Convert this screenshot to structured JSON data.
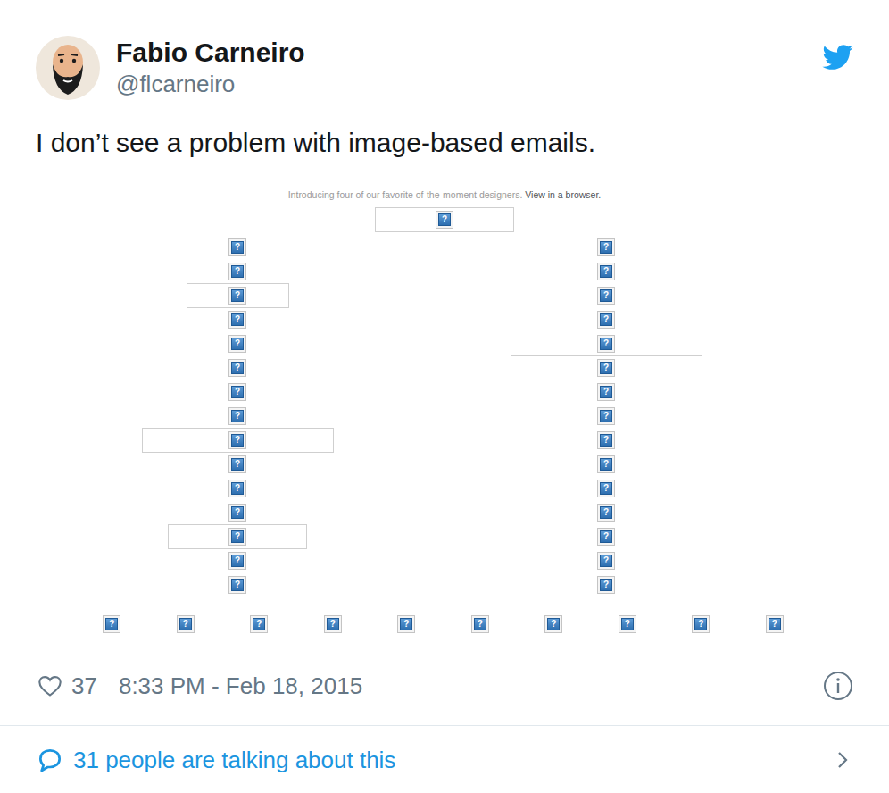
{
  "author": {
    "name": "Fabio Carneiro",
    "handle": "@flcarneiro"
  },
  "tweet": {
    "text": "I don’t see a problem with image-based emails."
  },
  "email": {
    "preheader": "Introducing four of our favorite of-the-moment designers.",
    "view_link": "View in a browser.",
    "broken_image_glyph": "?",
    "header_image": {
      "kind": "medium"
    },
    "columns": [
      {
        "items": [
          {
            "kind": "icon"
          },
          {
            "kind": "icon"
          },
          {
            "kind": "narrow"
          },
          {
            "kind": "icon"
          },
          {
            "kind": "icon"
          },
          {
            "kind": "icon"
          },
          {
            "kind": "icon"
          },
          {
            "kind": "icon"
          },
          {
            "kind": "wide"
          },
          {
            "kind": "icon"
          },
          {
            "kind": "icon"
          },
          {
            "kind": "icon"
          },
          {
            "kind": "medium"
          },
          {
            "kind": "icon"
          },
          {
            "kind": "icon"
          }
        ]
      },
      {
        "items": [
          {
            "kind": "icon"
          },
          {
            "kind": "icon"
          },
          {
            "kind": "icon"
          },
          {
            "kind": "icon"
          },
          {
            "kind": "icon"
          },
          {
            "kind": "wide"
          },
          {
            "kind": "icon"
          },
          {
            "kind": "icon"
          },
          {
            "kind": "icon"
          },
          {
            "kind": "icon"
          },
          {
            "kind": "icon"
          },
          {
            "kind": "icon"
          },
          {
            "kind": "icon"
          },
          {
            "kind": "icon"
          },
          {
            "kind": "icon"
          }
        ]
      }
    ],
    "footer_images": [
      {
        "kind": "icon"
      },
      {
        "kind": "icon"
      },
      {
        "kind": "icon"
      },
      {
        "kind": "icon"
      },
      {
        "kind": "icon"
      },
      {
        "kind": "icon"
      },
      {
        "kind": "icon"
      },
      {
        "kind": "icon"
      },
      {
        "kind": "icon"
      },
      {
        "kind": "icon"
      }
    ]
  },
  "likes": "37",
  "timestamp": "8:33 PM - Feb 18, 2015",
  "replies_link": "31 people are talking about this"
}
